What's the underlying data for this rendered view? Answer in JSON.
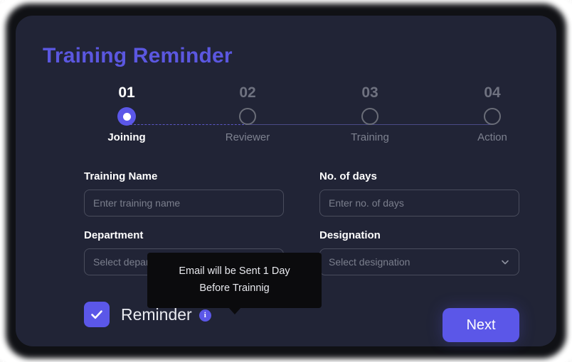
{
  "page": {
    "title": "Training Reminder",
    "accent_color": "#5b57e8",
    "title_color": "#5b57e0",
    "card_background": "#212436",
    "tooltip_background": "#0b0b0d"
  },
  "stepper": {
    "active_index": 0,
    "steps": [
      {
        "number": "01",
        "label": "Joining",
        "state": "active"
      },
      {
        "number": "02",
        "label": "Reviewer",
        "state": "inactive"
      },
      {
        "number": "03",
        "label": "Training",
        "state": "inactive"
      },
      {
        "number": "04",
        "label": "Action",
        "state": "inactive"
      }
    ]
  },
  "form": {
    "training_name": {
      "label": "Training Name",
      "placeholder": "Enter training name",
      "value": ""
    },
    "no_of_days": {
      "label": "No. of days",
      "placeholder": "Enter no. of days",
      "value": ""
    },
    "department": {
      "label": "Department",
      "placeholder": "Select department",
      "value": ""
    },
    "designation": {
      "label": "Designation",
      "placeholder": "Select designation",
      "value": ""
    }
  },
  "footer": {
    "reminder_label": "Reminder",
    "reminder_checked": true,
    "info_glyph": "i",
    "next_label": "Next"
  },
  "tooltip": {
    "line1": "Email will be Sent 1 Day",
    "line2": "Before Trainnig"
  },
  "icons": {
    "chevron_down": "chevron-down-icon",
    "check": "check-icon",
    "info": "info-icon"
  }
}
